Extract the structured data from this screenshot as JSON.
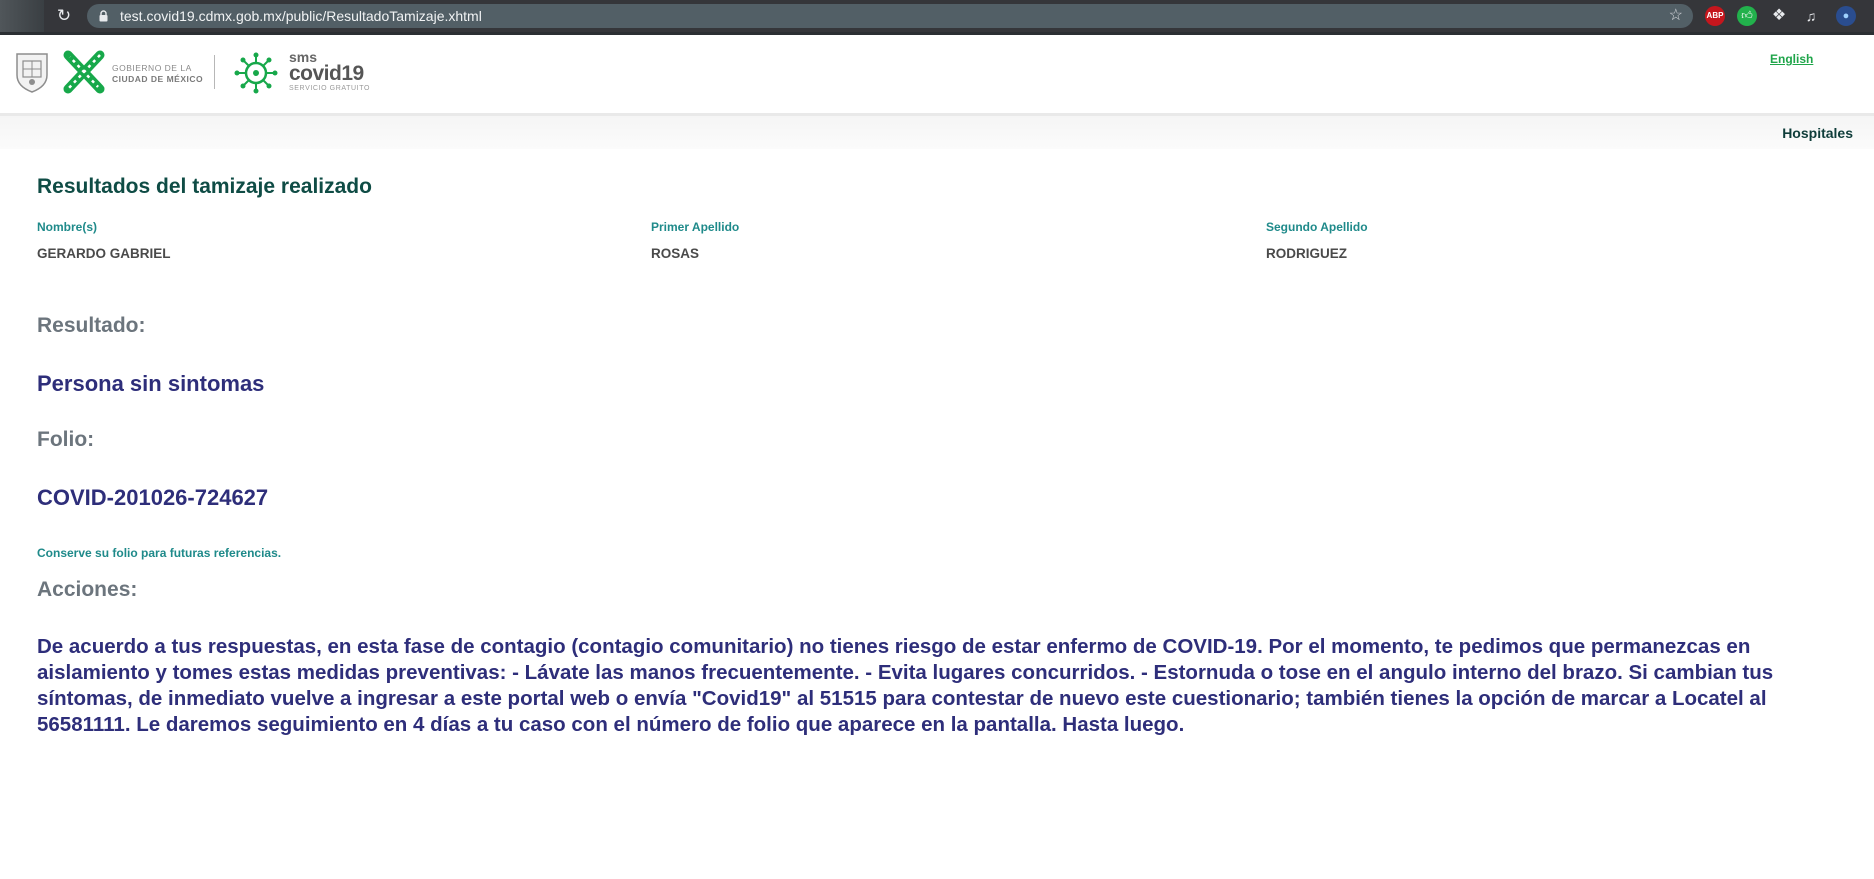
{
  "browser": {
    "url": "test.covid19.cdmx.gob.mx/public/ResultadoTamizaje.xhtml",
    "extensions": [
      "ABP",
      "thumbs-up",
      "puzzle",
      "media-queue",
      "profile-avatar"
    ],
    "abp_label": "ABP"
  },
  "header": {
    "gov_line1": "GOBIERNO DE LA",
    "gov_line2": "CIUDAD DE MÉXICO",
    "sms": "sms",
    "covid": "covid19",
    "servicio": "SERVICIO GRATUITO",
    "english_link": "English"
  },
  "nav": {
    "hospitales": "Hospitales"
  },
  "main": {
    "title": "Resultados del tamizaje realizado",
    "fields": [
      {
        "label": "Nombre(s)",
        "value": "GERARDO GABRIEL"
      },
      {
        "label": "Primer Apellido",
        "value": "ROSAS"
      },
      {
        "label": "Segundo Apellido",
        "value": "RODRIGUEZ"
      }
    ],
    "resultado_label": "Resultado:",
    "resultado_value": "Persona sin sintomas",
    "folio_label": "Folio:",
    "folio_value": "COVID-201026-724627",
    "folio_note": "Conserve su folio para futuras referencias.",
    "acciones_label": "Acciones:",
    "acciones_text": "De acuerdo a tus respuestas, en esta fase de contagio (contagio comunitario) no tienes riesgo de estar enfermo de COVID-19. Por el momento, te pedimos que permanezcas en aislamiento y tomes estas medidas preventivas: - Lávate las manos frecuentemente. - Evita lugares concurridos. - Estornuda o tose en el angulo interno del brazo. Si cambian tus síntomas, de inmediato vuelve a ingresar a este portal web o envía \"Covid19\" al 51515 para contestar de nuevo este cuestionario; también tienes la opción de marcar a Locatel al 56581111. Le daremos seguimiento en 4 días a tu caso con el número de folio que aparece en la pantalla. Hasta luego."
  },
  "colors": {
    "title": "#0f4c45",
    "field_label": "#1f8a8a",
    "result": "#2e2e7a",
    "section": "#6c757d",
    "link": "#1fa54a"
  }
}
